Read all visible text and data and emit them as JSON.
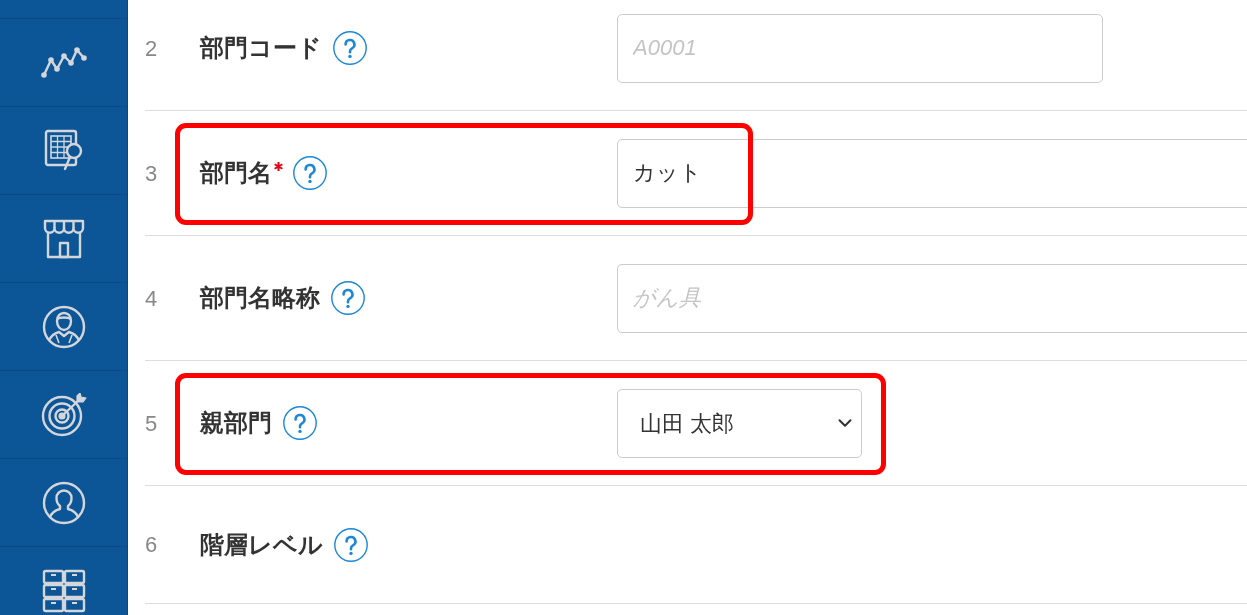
{
  "form": {
    "rows": [
      {
        "number": "2",
        "label": "部門コード",
        "required": false,
        "highlighted": false,
        "field": {
          "kind": "short_text",
          "placeholder": "A0001"
        }
      },
      {
        "number": "3",
        "label": "部門名",
        "required": true,
        "highlighted": true,
        "field": {
          "kind": "text",
          "value": "カット"
        }
      },
      {
        "number": "4",
        "label": "部門名略称",
        "required": false,
        "highlighted": false,
        "field": {
          "kind": "text",
          "placeholder": "がん具"
        }
      },
      {
        "number": "5",
        "label": "親部門",
        "required": false,
        "highlighted": true,
        "field": {
          "kind": "select",
          "value": "山田 太郎"
        }
      },
      {
        "number": "6",
        "label": "階層レベル",
        "required": false,
        "highlighted": false
      }
    ]
  }
}
